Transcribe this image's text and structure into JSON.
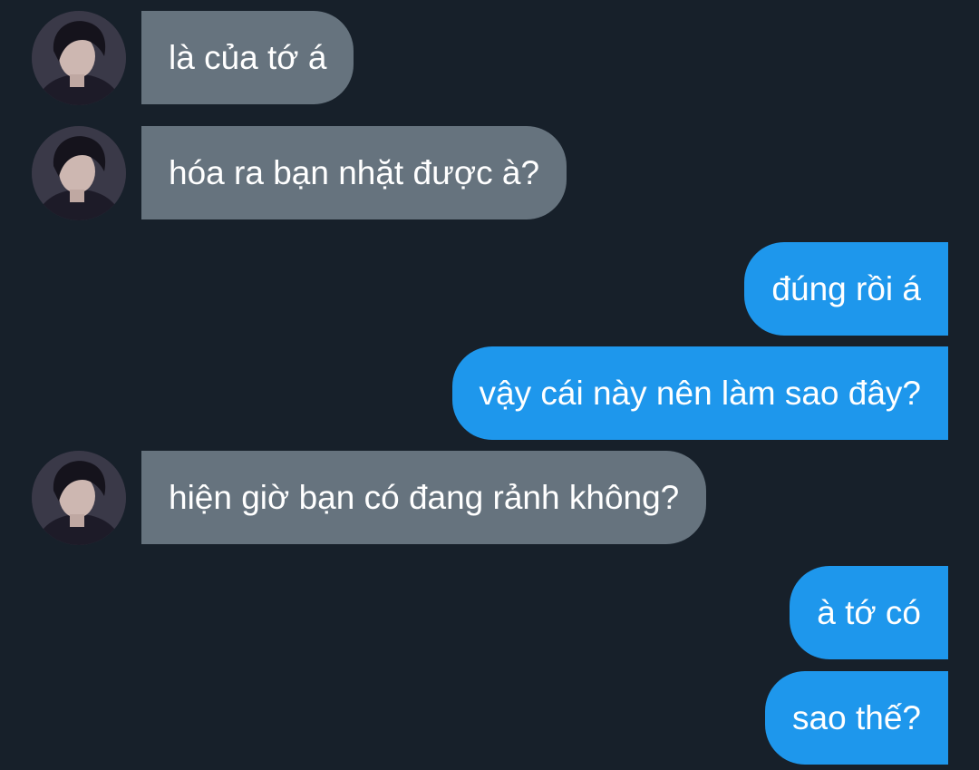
{
  "colors": {
    "background": "#17202a",
    "incoming_bubble": "#66737e",
    "outgoing_bubble": "#1e97ec",
    "text": "#ffffff"
  },
  "messages": [
    {
      "direction": "incoming",
      "text": "là của tớ á",
      "has_avatar": true
    },
    {
      "direction": "incoming",
      "text": "hóa ra bạn nhặt được à?",
      "has_avatar": true
    },
    {
      "direction": "outgoing",
      "text": "đúng rồi á"
    },
    {
      "direction": "outgoing",
      "text": "vậy cái này nên làm sao đây?"
    },
    {
      "direction": "incoming",
      "text": "hiện giờ bạn có đang rảnh không?",
      "has_avatar": true
    },
    {
      "direction": "outgoing",
      "text": "à tớ có"
    },
    {
      "direction": "outgoing",
      "text": "sao thế?"
    }
  ]
}
